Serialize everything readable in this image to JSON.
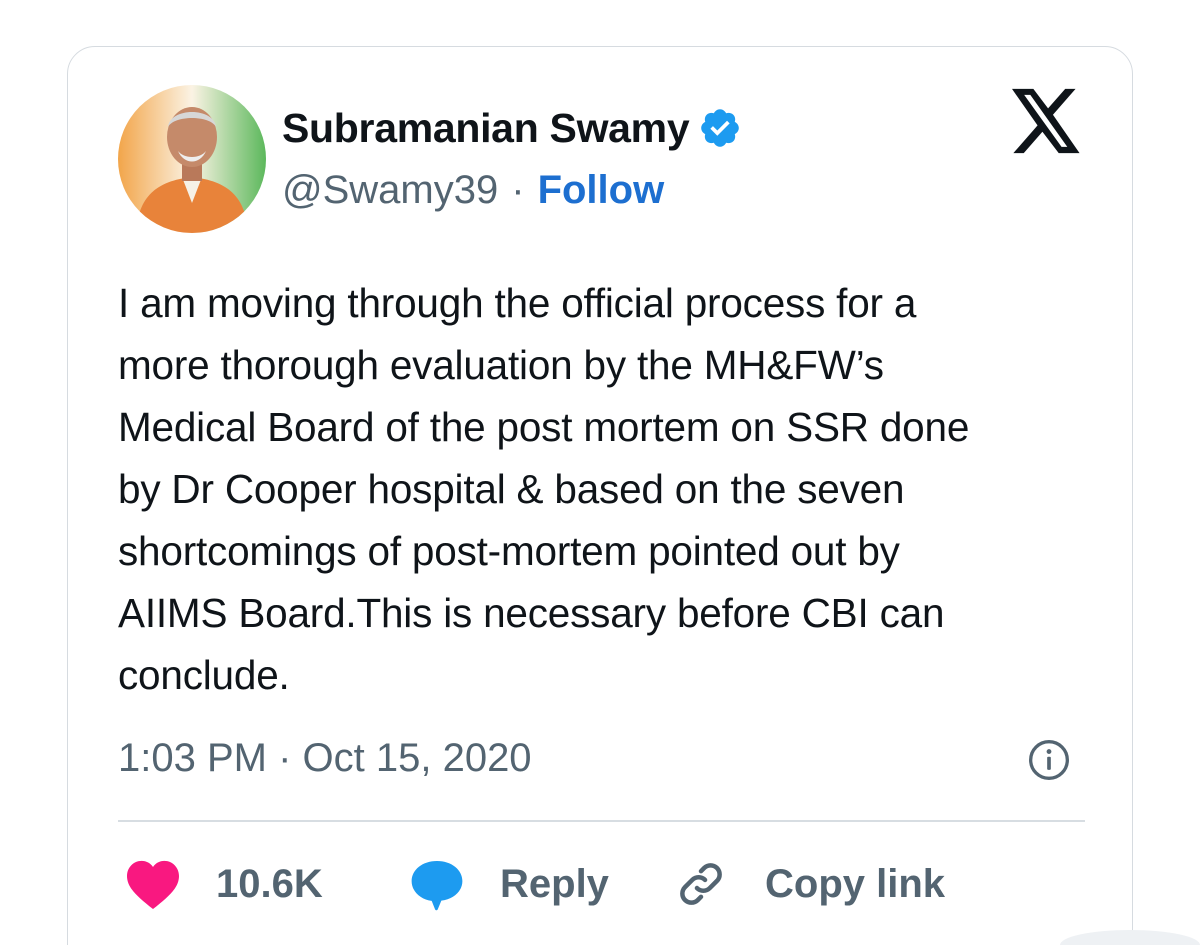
{
  "author": {
    "display_name": "Subramanian Swamy",
    "handle": "@Swamy39",
    "separator": "·",
    "follow_label": "Follow",
    "verified": true,
    "avatar_icon": "profile-photo"
  },
  "platform": {
    "logo_icon": "x-logo"
  },
  "tweet": {
    "text": "I am moving through the official process for a\nmore thorough evaluation by the MH&FW’s\nMedical Board of the post mortem on SSR done\nby Dr Cooper hospital & based on the seven\nshortcomings of post-mortem pointed out by\nAIIMS Board.This is necessary before CBI can\nconclude.",
    "timestamp": "1:03 PM · Oct 15, 2020"
  },
  "actions": {
    "like_count": "10.6K",
    "reply_label": "Reply",
    "copy_link_label": "Copy link"
  },
  "colors": {
    "text": "#0f1419",
    "secondary": "#536471",
    "follow": "#1d6fd0",
    "verified": "#1d9bf0",
    "like": "#f91880",
    "reply": "#1d9bf0",
    "border": "#d6dbe0"
  }
}
